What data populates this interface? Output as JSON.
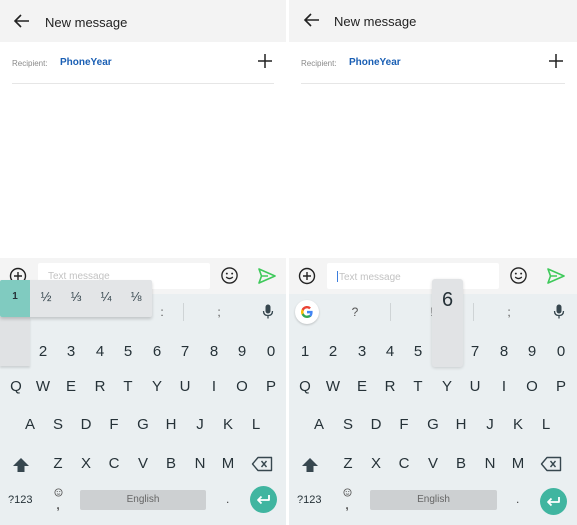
{
  "screens": [
    {
      "appbar": {
        "title": "New message",
        "back_icon": "arrow-left-icon"
      },
      "recipient": {
        "label": "Recipient:",
        "name": "PhoneYear",
        "add_icon": "plus-icon"
      },
      "compose": {
        "placeholder": "Text message",
        "attach_icon": "plus-circle-icon",
        "emoji_icon": "smiley-icon",
        "send_icon": "send-icon",
        "send_color": "#3ec95a"
      },
      "keyboard": {
        "suggestions": [
          ":",
          ";"
        ],
        "popup": {
          "selected": "1",
          "options": [
            "½",
            "⅓",
            "¼",
            "⅛"
          ],
          "highlight_color": "#80cbc0"
        },
        "numbers": [
          "1",
          "2",
          "3",
          "4",
          "5",
          "6",
          "7",
          "8",
          "9",
          "0"
        ],
        "row_q": [
          "Q",
          "W",
          "E",
          "R",
          "T",
          "Y",
          "U",
          "I",
          "O",
          "P"
        ],
        "row_a": [
          "A",
          "S",
          "D",
          "F",
          "G",
          "H",
          "J",
          "K",
          "L"
        ],
        "row_z": [
          "Z",
          "X",
          "C",
          "V",
          "B",
          "N",
          "M"
        ],
        "symbols_label": "?123",
        "emoji_comma": ",",
        "space_label": "English",
        "period": ".",
        "enter_color": "#40b5a0"
      }
    },
    {
      "appbar": {
        "title": "New message",
        "back_icon": "arrow-left-icon"
      },
      "recipient": {
        "label": "Recipient:",
        "name": "PhoneYear",
        "add_icon": "plus-icon"
      },
      "compose": {
        "placeholder": "Text message",
        "attach_icon": "plus-circle-icon",
        "emoji_icon": "smiley-icon",
        "send_icon": "send-icon",
        "send_color": "#3ec95a"
      },
      "keyboard": {
        "suggestions": [
          "?",
          "!",
          ";"
        ],
        "key_preview": "6",
        "numbers": [
          "1",
          "2",
          "3",
          "4",
          "5",
          "6",
          "7",
          "8",
          "9",
          "0"
        ],
        "row_q": [
          "Q",
          "W",
          "E",
          "R",
          "T",
          "Y",
          "U",
          "I",
          "O",
          "P"
        ],
        "row_a": [
          "A",
          "S",
          "D",
          "F",
          "G",
          "H",
          "J",
          "K",
          "L"
        ],
        "row_z": [
          "Z",
          "X",
          "C",
          "V",
          "B",
          "N",
          "M"
        ],
        "symbols_label": "?123",
        "emoji_comma": ",",
        "space_label": "English",
        "period": ".",
        "enter_color": "#40b5a0"
      }
    }
  ]
}
